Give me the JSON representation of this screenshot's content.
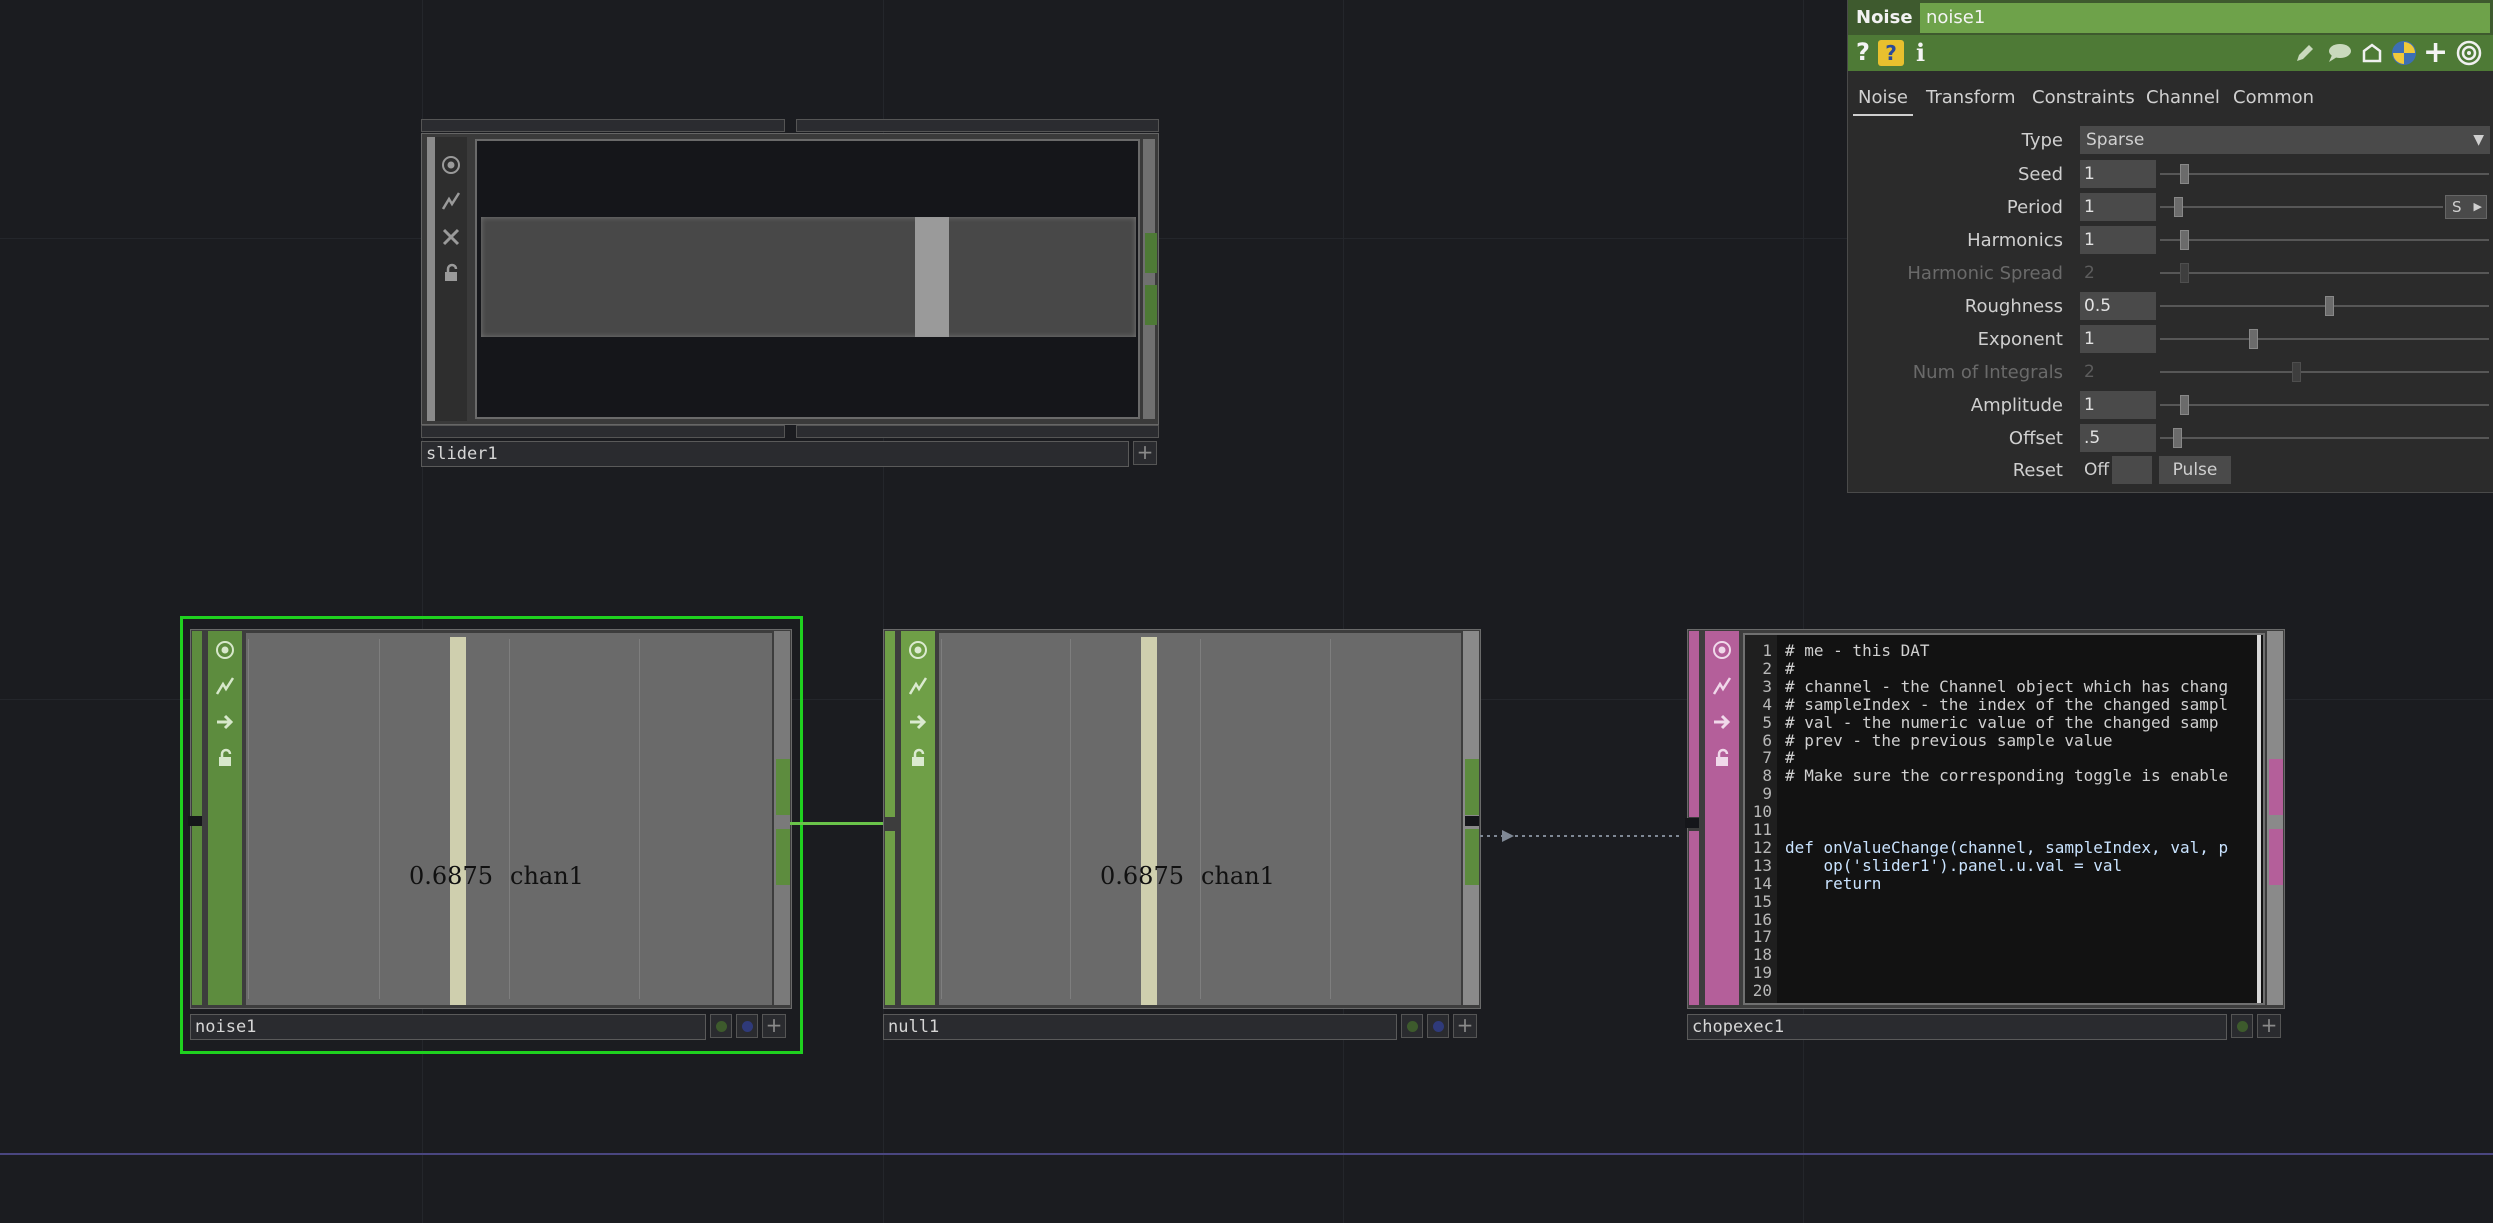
{
  "network": {
    "background": "#1b1c20",
    "link_color_noise_to_null": "#6ac44a",
    "selected_outline_color": "#1fd11f"
  },
  "slider_node": {
    "name": "slider1",
    "plus_label": "+",
    "side_icons": [
      "viewer-active-icon",
      "bypass-icon",
      "cook-flag-icon",
      "lock-icon"
    ]
  },
  "noise_node": {
    "name": "noise1",
    "value": "0.6875",
    "channel": "chan1",
    "plus_label": "+",
    "side_icons": [
      "viewer-active-icon",
      "bypass-icon",
      "export-arrow-icon",
      "lock-icon"
    ],
    "frame_color": "#5d8c3e",
    "selected": true
  },
  "null_node": {
    "name": "null1",
    "value": "0.6875",
    "channel": "chan1",
    "plus_label": "+",
    "side_icons": [
      "viewer-active-icon",
      "bypass-icon",
      "export-arrow-icon",
      "lock-icon"
    ],
    "frame_color": "#6f9f47"
  },
  "chopexec_node": {
    "name": "chopexec1",
    "plus_label": "+",
    "frame_color": "#b45f9a",
    "side_icons": [
      "viewer-active-icon",
      "bypass-icon",
      "export-arrow-icon",
      "lock-icon"
    ],
    "code_lines": [
      {
        "n": "1",
        "t": "# me - this DAT",
        "kind": "comment"
      },
      {
        "n": "2",
        "t": "#",
        "kind": "comment"
      },
      {
        "n": "3",
        "t": "# channel - the Channel object which has chang",
        "kind": "comment"
      },
      {
        "n": "4",
        "t": "# sampleIndex - the index of the changed sampl",
        "kind": "comment"
      },
      {
        "n": "5",
        "t": "# val - the numeric value of the changed samp",
        "kind": "comment"
      },
      {
        "n": "6",
        "t": "# prev - the previous sample value",
        "kind": "comment"
      },
      {
        "n": "7",
        "t": "#",
        "kind": "comment"
      },
      {
        "n": "8",
        "t": "# Make sure the corresponding toggle is enable",
        "kind": "comment"
      },
      {
        "n": "9",
        "t": "",
        "kind": "comment"
      },
      {
        "n": "10",
        "t": "",
        "kind": "comment"
      },
      {
        "n": "11",
        "t": "",
        "kind": "comment"
      },
      {
        "n": "12",
        "t": "def onValueChange(channel, sampleIndex, val, p",
        "kind": "code"
      },
      {
        "n": "13",
        "t": "    op('slider1').panel.u.val = val",
        "kind": "code"
      },
      {
        "n": "14",
        "t": "    return",
        "kind": "code"
      },
      {
        "n": "15",
        "t": "",
        "kind": "code"
      },
      {
        "n": "16",
        "t": "",
        "kind": "code"
      },
      {
        "n": "17",
        "t": "",
        "kind": "code"
      },
      {
        "n": "18",
        "t": "",
        "kind": "code"
      },
      {
        "n": "19",
        "t": "",
        "kind": "code"
      },
      {
        "n": "20",
        "t": "",
        "kind": "code"
      }
    ]
  },
  "param_panel": {
    "op_type": "Noise",
    "op_name": "noise1",
    "header_color": "#3e5a2e",
    "toolbar_color": "#4e7a36",
    "toolbar_left": {
      "help": "?",
      "python_help": "?",
      "info": "i"
    },
    "toolbar_right_icons": [
      "edit-icon",
      "comment-icon",
      "clone-icon",
      "python-icon",
      "add-icon",
      "target-icon"
    ],
    "tabs": [
      "Noise",
      "Transform",
      "Constraints",
      "Channel",
      "Common"
    ],
    "active_tab": "Noise",
    "type": {
      "label": "Type",
      "value": "Sparse"
    },
    "params": [
      {
        "label": "Seed",
        "value": "1",
        "slider": 0.06,
        "enabled": true
      },
      {
        "label": "Period",
        "value": "1",
        "slider": 0.05,
        "enabled": true,
        "extra_button": "S"
      },
      {
        "label": "Harmonics",
        "value": "1",
        "slider": 0.06,
        "enabled": true
      },
      {
        "label": "Harmonic Spread",
        "value": "2",
        "slider": 0.06,
        "enabled": false
      },
      {
        "label": "Roughness",
        "value": "0.5",
        "slider": 0.5,
        "enabled": true
      },
      {
        "label": "Exponent",
        "value": "1",
        "slider": 0.27,
        "enabled": true
      },
      {
        "label": "Num of Integrals",
        "value": "2",
        "slider": 0.4,
        "enabled": false
      },
      {
        "label": "Amplitude",
        "value": "1",
        "slider": 0.06,
        "enabled": true
      },
      {
        "label": "Offset",
        "value": ".5",
        "slider": 0.04,
        "enabled": true
      }
    ],
    "reset": {
      "label": "Reset",
      "toggle": "Off",
      "pulse": "Pulse"
    }
  }
}
